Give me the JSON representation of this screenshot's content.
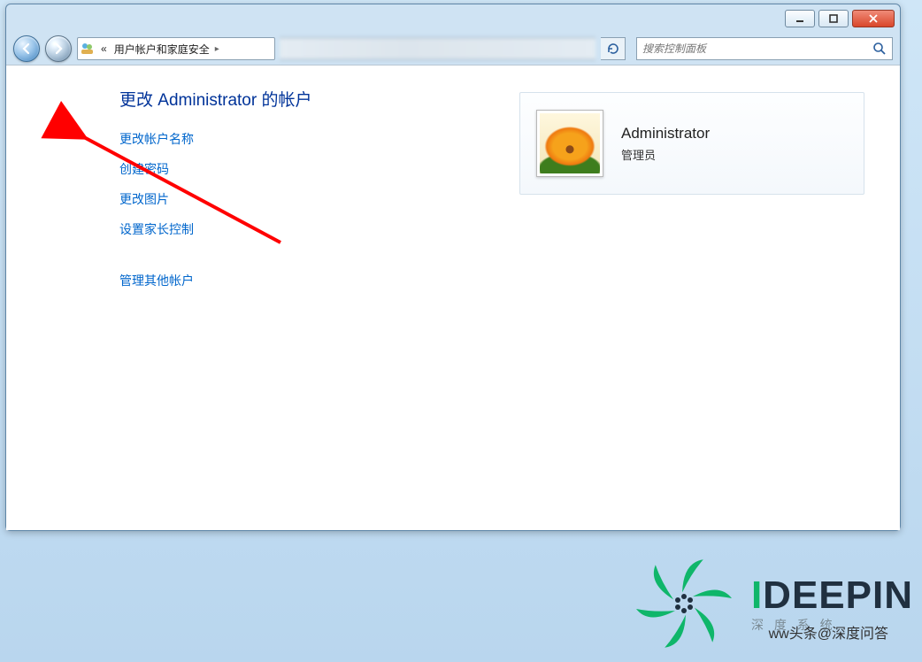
{
  "breadcrumb": {
    "prefix": "«",
    "item1": "用户帐户和家庭安全",
    "caret": "▸"
  },
  "search": {
    "placeholder": "搜索控制面板"
  },
  "heading": "更改 Administrator 的帐户",
  "tasks": {
    "change_name": "更改帐户名称",
    "create_password": "创建密码",
    "change_picture": "更改图片",
    "parental": "设置家长控制",
    "manage_other": "管理其他帐户"
  },
  "account": {
    "name": "Administrator",
    "role": "管理员"
  },
  "watermark": {
    "brand_i": "I",
    "brand_rest": "DEEPIN",
    "sub": "深 度 系 统",
    "attrib_prefix": "ww头条@",
    "attrib_name": "深度问答"
  }
}
